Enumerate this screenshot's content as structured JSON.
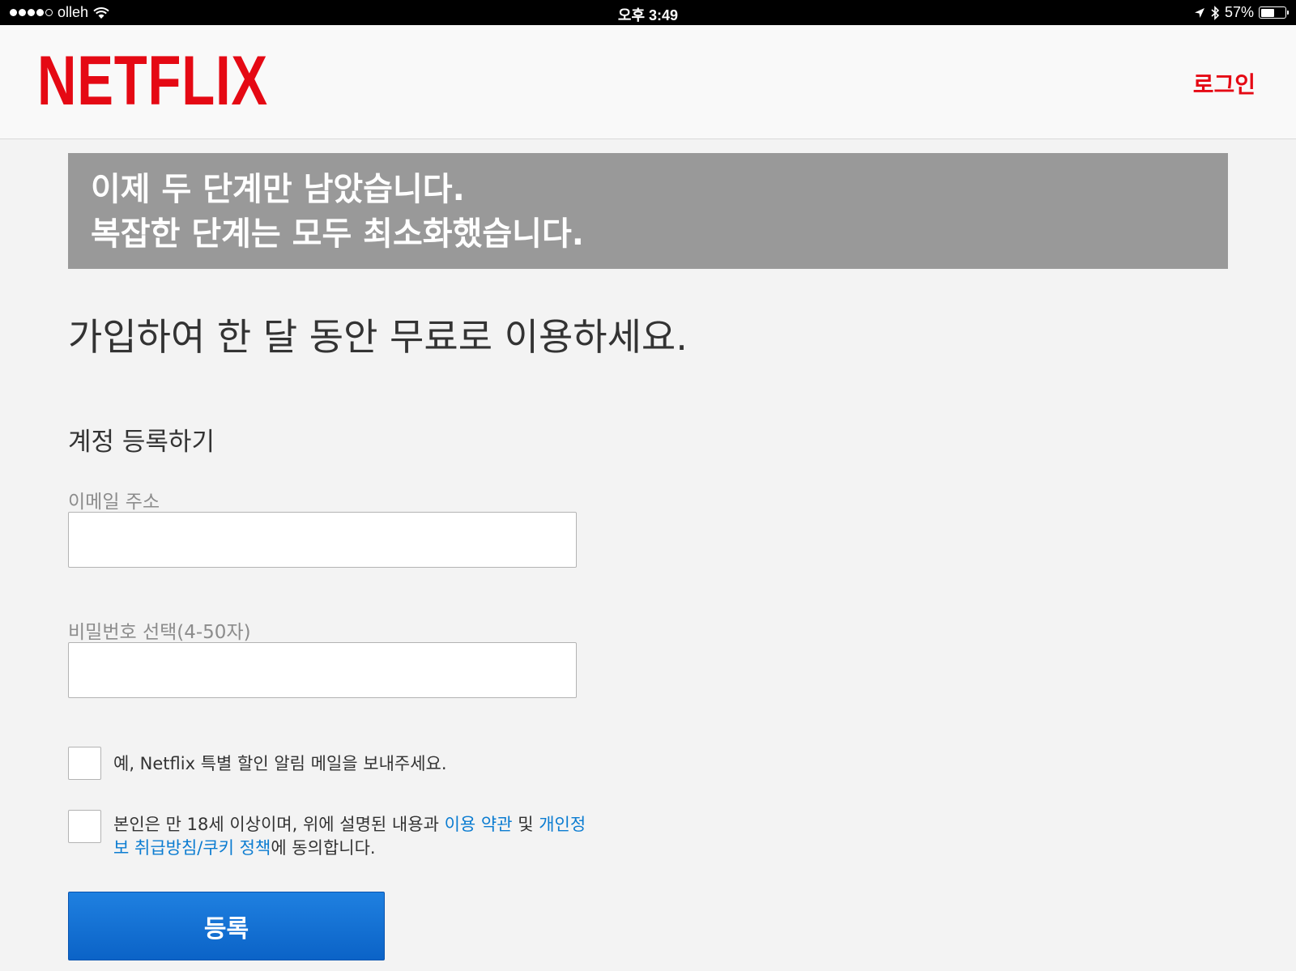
{
  "status_bar": {
    "carrier": "olleh",
    "signal_icon": "signal-dots-icon",
    "wifi_icon": "wifi-icon",
    "time": "오후 3:49",
    "location_icon": "location-arrow-icon",
    "bluetooth_icon": "bluetooth-icon",
    "battery_percent_label": "57%",
    "battery_level": 0.57
  },
  "header": {
    "logo_text": "NETFLIX",
    "login_label": "로그인"
  },
  "banner": {
    "line1": "이제 두 단계만 남았습니다.",
    "line2": "복잡한 단계는 모두 최소화했습니다."
  },
  "main": {
    "headline": "가입하여 한 달 동안 무료로 이용하세요.",
    "section_title": "계정 등록하기",
    "email": {
      "label": "이메일 주소",
      "value": ""
    },
    "password": {
      "label": "비밀번호 선택(4-50자)",
      "value": ""
    },
    "marketing_checkbox": {
      "checked": false,
      "label": "예, Netflix 특별 할인 알림 메일을 보내주세요."
    },
    "terms_checkbox": {
      "checked": false,
      "text_before": "본인은 만 18세 이상이며, 위에 설명된 내용과 ",
      "terms_link": "이용 약관",
      "text_middle": " 및 ",
      "privacy_link": "개인정보 취급방침/쿠키 정책",
      "text_after": "에 동의합니다."
    },
    "submit_label": "등록"
  },
  "colors": {
    "brand_red": "#e50914",
    "link_blue": "#0b7cd1",
    "button_blue": "#1f80e0",
    "banner_gray": "#999999"
  }
}
